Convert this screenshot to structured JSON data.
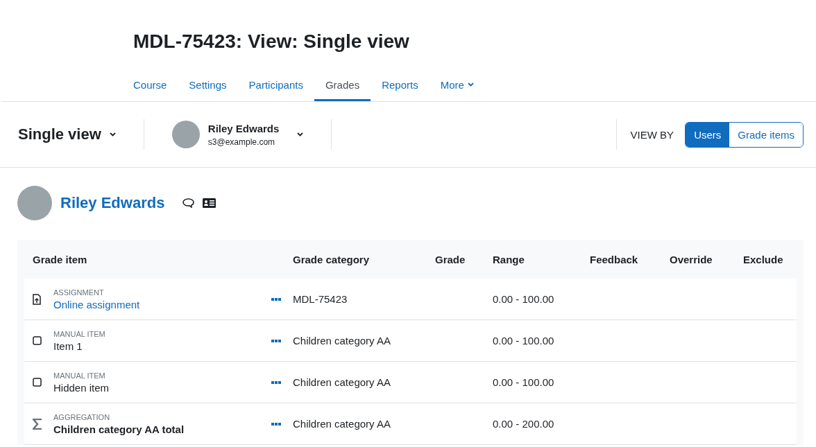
{
  "page_title": "MDL-75423: View: Single view",
  "nav_tabs": [
    {
      "label": "Course",
      "selected": false
    },
    {
      "label": "Settings",
      "selected": false
    },
    {
      "label": "Participants",
      "selected": false
    },
    {
      "label": "Grades",
      "selected": true
    },
    {
      "label": "Reports",
      "selected": false
    },
    {
      "label": "More",
      "selected": false,
      "has_menu": true
    }
  ],
  "report_selector": {
    "label": "Single view"
  },
  "user_selector": {
    "name": "Riley Edwards",
    "email": "s3@example.com"
  },
  "view_by": {
    "label": "VIEW BY",
    "options": [
      {
        "label": "Users",
        "selected": true
      },
      {
        "label": "Grade items",
        "selected": false
      }
    ]
  },
  "user_heading": {
    "name": "Riley Edwards"
  },
  "table": {
    "columns": [
      "Grade item",
      "Grade category",
      "Grade",
      "Range",
      "Feedback",
      "Override",
      "Exclude"
    ],
    "rows": [
      {
        "kind": "assignment",
        "type_label": "ASSIGNMENT",
        "name": "Online assignment",
        "category": "MDL-75423",
        "range": "0.00 - 100.00"
      },
      {
        "kind": "manual",
        "type_label": "MANUAL ITEM",
        "name": "Item 1",
        "category": "Children category AA",
        "range": "0.00 - 100.00"
      },
      {
        "kind": "manual",
        "type_label": "MANUAL ITEM",
        "name": "Hidden item",
        "category": "Children category AA",
        "range": "0.00 - 100.00"
      },
      {
        "kind": "aggregation",
        "type_label": "AGGREGATION",
        "name": "Children category AA total",
        "category": "Children category AA",
        "range": "0.00 - 200.00"
      }
    ]
  }
}
